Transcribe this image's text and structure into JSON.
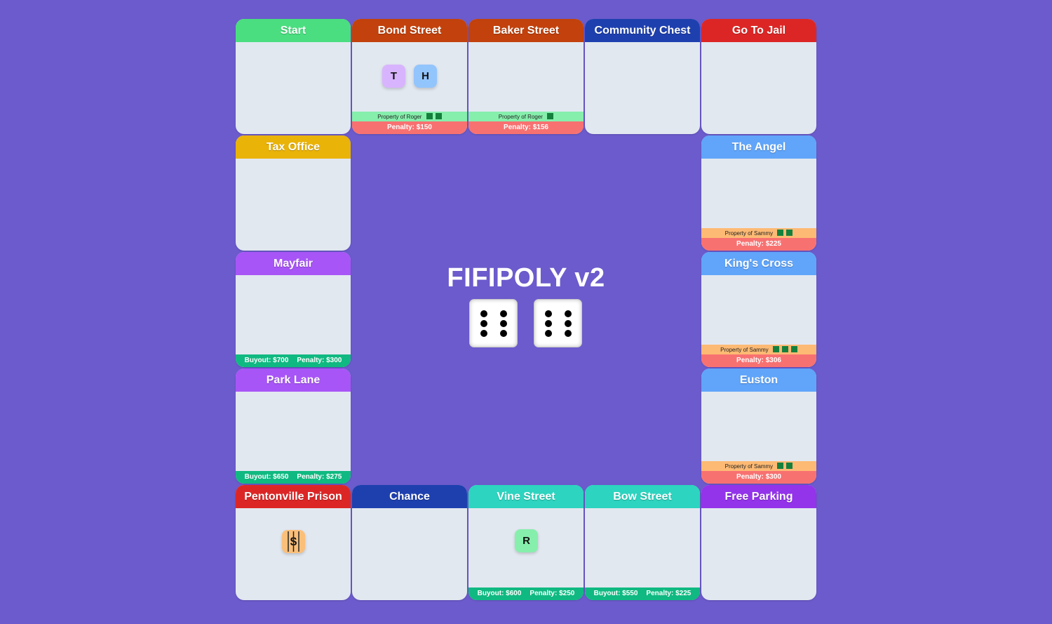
{
  "game_title": "FIFIPOLY v2",
  "dice": [
    {
      "value": 6
    },
    {
      "value": 6
    }
  ],
  "colors": {
    "background": "#6b5bcc",
    "tile_body": "#e2e8f0",
    "penalty": "#f87171",
    "buyout": "#10b981",
    "owner_roger": "#86efac",
    "owner_sammy": "#fdba74",
    "house": "#15803d"
  },
  "tiles": {
    "start": {
      "name": "Start",
      "color": "#4ade80"
    },
    "bond_street": {
      "name": "Bond Street",
      "color": "#c2410c",
      "owner_prefix": "Property of",
      "owner": "Roger",
      "houses": 2,
      "penalty": "Penalty: $150",
      "tokens": [
        "T",
        "H"
      ]
    },
    "baker_street": {
      "name": "Baker Street",
      "color": "#c2410c",
      "owner_prefix": "Property of",
      "owner": "Roger",
      "houses": 1,
      "penalty": "Penalty: $156"
    },
    "community_chest": {
      "name": "Community Chest",
      "color": "#1e40af"
    },
    "go_to_jail": {
      "name": "Go To Jail",
      "color": "#dc2626"
    },
    "tax_office": {
      "name": "Tax Office",
      "color": "#eab308"
    },
    "the_angel": {
      "name": "The Angel",
      "color": "#60a5fa",
      "owner_prefix": "Property of",
      "owner": "Sammy",
      "houses": 2,
      "penalty": "Penalty: $225"
    },
    "mayfair": {
      "name": "Mayfair",
      "color": "#a855f7",
      "buyout": "Buyout: $700",
      "penalty": "Penalty: $300"
    },
    "kings_cross": {
      "name": "King's Cross",
      "color": "#60a5fa",
      "owner_prefix": "Property of",
      "owner": "Sammy",
      "houses": 3,
      "penalty": "Penalty: $306"
    },
    "park_lane": {
      "name": "Park Lane",
      "color": "#a855f7",
      "buyout": "Buyout: $650",
      "penalty": "Penalty: $275"
    },
    "euston": {
      "name": "Euston",
      "color": "#60a5fa",
      "owner_prefix": "Property of",
      "owner": "Sammy",
      "houses": 2,
      "penalty": "Penalty: $300"
    },
    "pentonville_prison": {
      "name": "Pentonville Prison",
      "color": "#dc2626",
      "jailed_token": "$"
    },
    "chance": {
      "name": "Chance",
      "color": "#1e40af"
    },
    "vine_street": {
      "name": "Vine Street",
      "color": "#2dd4bf",
      "buyout": "Buyout: $600",
      "penalty": "Penalty: $250",
      "tokens": [
        "R"
      ]
    },
    "bow_street": {
      "name": "Bow Street",
      "color": "#2dd4bf",
      "buyout": "Buyout: $550",
      "penalty": "Penalty: $225"
    },
    "free_parking": {
      "name": "Free Parking",
      "color": "#9333ea"
    }
  },
  "token_colors": {
    "T": "#d8b4fe",
    "H": "#93c5fd",
    "R": "#86efac"
  }
}
